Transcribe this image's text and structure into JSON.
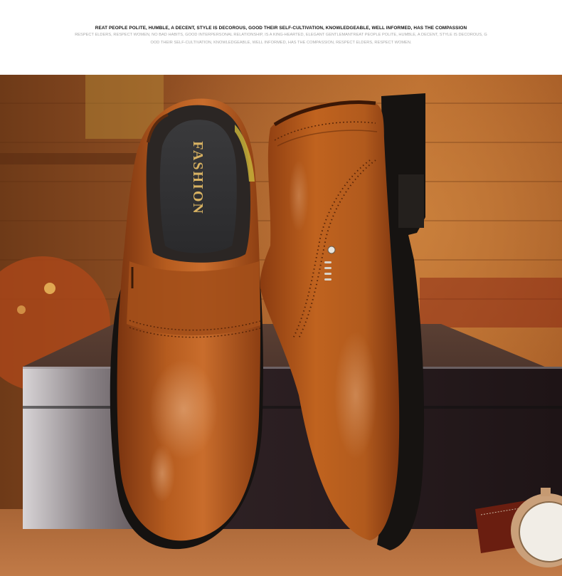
{
  "header": {
    "title": "REAT PEOPLE POLITE, HUMBLE, A DECENT, STYLE IS DECOROUS, GOOD THEIR SELF-CULTIVATION, KNOWLEDGEABLE, WELL INFORMED, HAS THE COMPASSION",
    "line2": "RESPECT ELDERS, RESPECT WOMEN, NO BAD HABITS, GOOD INTERPERSONAL RELATIONSHIP, IS A KING-HEARTED, ELEGANT GENTLEMANTREAT PEOPLE POLITE, HUMBLE, A DECENT, STYLE IS DECOROUS, G",
    "line3": "OOD THEIR SELF-CULTIVATION, KNOWLEDGEABLE, WELL INFORMED, HAS THE COMPASSION, RESPECT ELDERS, RESPECT WOMEN."
  },
  "photo": {
    "insole_text": "FASHION",
    "subject": "brown-leather-slip-on-dress-shoes",
    "colors": {
      "leather": "#a8521b",
      "leather_dark": "#6a2d0d",
      "sole": "#1a1714",
      "wood_bg": "#8a4a1f",
      "box": "#24191a"
    }
  }
}
